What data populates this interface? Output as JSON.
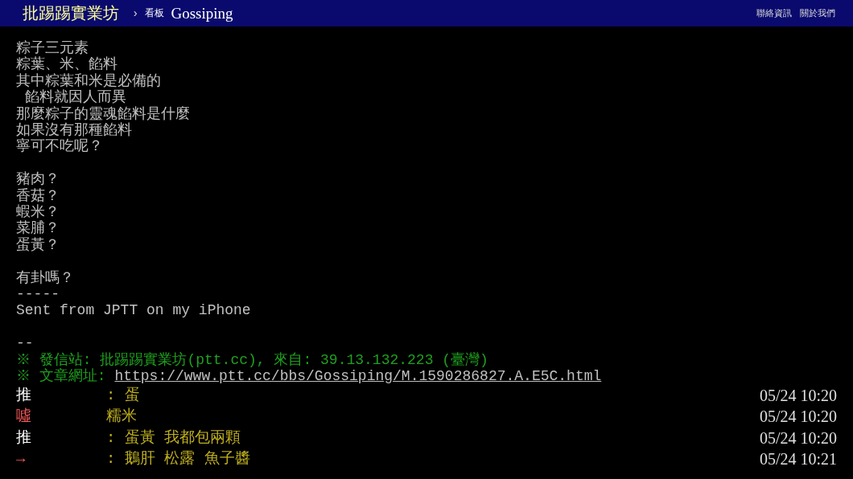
{
  "header": {
    "site": "批踢踢實業坊",
    "separator": "›",
    "board_label": "看板",
    "board": "Gossiping",
    "links": [
      "聯絡資訊",
      "關於我們"
    ]
  },
  "body": [
    [
      "粽子三元素",
      "粽葉、米、餡料",
      "其中粽葉和米是必備的",
      " 餡料就因人而異",
      "那麼粽子的靈魂餡料是什麼",
      "如果沒有那種餡料",
      "寧可不吃呢？"
    ],
    [
      "豬肉？",
      "香菇？",
      "蝦米？",
      "菜脯？",
      "蛋黃？"
    ],
    [
      "有卦嗎？",
      "-----",
      "Sent from JPTT on my iPhone"
    ]
  ],
  "signature": {
    "divider": "--",
    "origin": "※ 發信站: 批踢踢實業坊(ptt.cc), 來自: 39.13.132.223 (臺灣)",
    "url_label": "※ 文章網址: ",
    "url": "https://www.ptt.cc/bbs/Gossiping/M.1590286827.A.E5C.html"
  },
  "comments": [
    {
      "kind": "push",
      "tag": "推",
      "content": ": 蛋",
      "time": "05/24 10:20"
    },
    {
      "kind": "boo",
      "tag": "噓",
      "content": "糯米",
      "time": "05/24 10:20"
    },
    {
      "kind": "push",
      "tag": "推",
      "content": ": 蛋黃 我都包兩顆",
      "time": "05/24 10:20"
    },
    {
      "kind": "arrow",
      "tag": "→",
      "content": ": 鵝肝 松露 魚子醬",
      "time": "05/24 10:21"
    }
  ]
}
